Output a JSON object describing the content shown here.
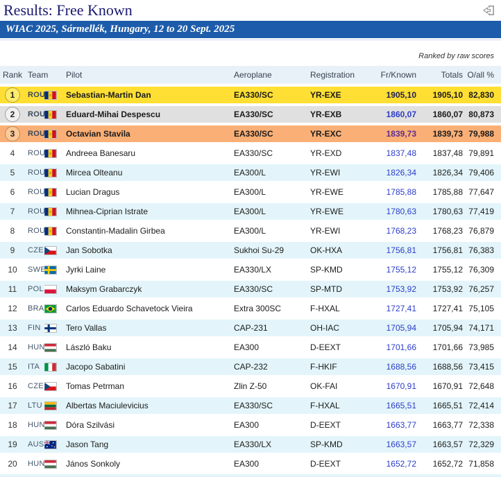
{
  "header": {
    "title": "Results: Free Known",
    "event": "WIAC 2025, Sármellék, Hungary, 12 to 20 Sept. 2025",
    "ranked_note": "Ranked by raw scores"
  },
  "colors": {
    "title_navy": "#191970",
    "event_bar_blue": "#1d5caa",
    "gold_row": "#ffdf33",
    "silver_row": "#e0e0e0",
    "bronze_row": "#faaf76",
    "alt_row_cyan": "#e3f5fa",
    "header_row_bg": "#e9f1f8",
    "link_blue": "#2b3cc8",
    "link_visited_purple": "#5e2d91",
    "link_dark_navy": "#20204e"
  },
  "icons": {
    "logout": "logout-icon"
  },
  "table": {
    "columns": [
      "Rank",
      "Team",
      "",
      "Pilot",
      "Aeroplane",
      "Registration",
      "Fr/Known",
      "Totals",
      "O/all %"
    ],
    "rows": [
      {
        "rank": 1,
        "team": "ROU",
        "flag": "rou",
        "pilot": "Sebastian-Martin Dan",
        "aeroplane": "EA330/SC",
        "registration": "YR-EXE",
        "fr_known": "1905,10",
        "totals": "1905,10",
        "overall": "82,830",
        "highlight": "gold",
        "link": "dark"
      },
      {
        "rank": 2,
        "team": "ROU",
        "flag": "rou",
        "pilot": "Eduard-Mihai Despescu",
        "aeroplane": "EA330/SC",
        "registration": "YR-EXB",
        "fr_known": "1860,07",
        "totals": "1860,07",
        "overall": "80,873",
        "highlight": "silver",
        "link": "blue"
      },
      {
        "rank": 3,
        "team": "ROU",
        "flag": "rou",
        "pilot": "Octavian Stavila",
        "aeroplane": "EA330/SC",
        "registration": "YR-EXC",
        "fr_known": "1839,73",
        "totals": "1839,73",
        "overall": "79,988",
        "highlight": "bronze",
        "link": "visited"
      },
      {
        "rank": 4,
        "team": "ROU",
        "flag": "rou",
        "pilot": "Andreea Banesaru",
        "aeroplane": "EA330/SC",
        "registration": "YR-EXD",
        "fr_known": "1837,48",
        "totals": "1837,48",
        "overall": "79,891",
        "highlight": "",
        "link": "blue"
      },
      {
        "rank": 5,
        "team": "ROU",
        "flag": "rou",
        "pilot": "Mircea Olteanu",
        "aeroplane": "EA300/L",
        "registration": "YR-EWI",
        "fr_known": "1826,34",
        "totals": "1826,34",
        "overall": "79,406",
        "highlight": "",
        "link": "blue"
      },
      {
        "rank": 6,
        "team": "ROU",
        "flag": "rou",
        "pilot": "Lucian Dragus",
        "aeroplane": "EA300/L",
        "registration": "YR-EWE",
        "fr_known": "1785,88",
        "totals": "1785,88",
        "overall": "77,647",
        "highlight": "",
        "link": "blue"
      },
      {
        "rank": 7,
        "team": "ROU",
        "flag": "rou",
        "pilot": "Mihnea-Ciprian Istrate",
        "aeroplane": "EA300/L",
        "registration": "YR-EWE",
        "fr_known": "1780,63",
        "totals": "1780,63",
        "overall": "77,419",
        "highlight": "",
        "link": "blue"
      },
      {
        "rank": 8,
        "team": "ROU",
        "flag": "rou",
        "pilot": "Constantin-Madalin Girbea",
        "aeroplane": "EA300/L",
        "registration": "YR-EWI",
        "fr_known": "1768,23",
        "totals": "1768,23",
        "overall": "76,879",
        "highlight": "",
        "link": "blue"
      },
      {
        "rank": 9,
        "team": "CZE",
        "flag": "cze",
        "pilot": "Jan Sobotka",
        "aeroplane": "Sukhoi Su-29",
        "registration": "OK-HXA",
        "fr_known": "1756,81",
        "totals": "1756,81",
        "overall": "76,383",
        "highlight": "",
        "link": "blue"
      },
      {
        "rank": 10,
        "team": "SWE",
        "flag": "swe",
        "pilot": "Jyrki Laine",
        "aeroplane": "EA330/LX",
        "registration": "SP-KMD",
        "fr_known": "1755,12",
        "totals": "1755,12",
        "overall": "76,309",
        "highlight": "",
        "link": "blue"
      },
      {
        "rank": 11,
        "team": "POL",
        "flag": "pol",
        "pilot": "Maksym Grabarczyk",
        "aeroplane": "EA330/SC",
        "registration": "SP-MTD",
        "fr_known": "1753,92",
        "totals": "1753,92",
        "overall": "76,257",
        "highlight": "",
        "link": "blue"
      },
      {
        "rank": 12,
        "team": "BRA",
        "flag": "bra",
        "pilot": "Carlos Eduardo Schavetock Vieira",
        "aeroplane": "Extra 300SC",
        "registration": "F-HXAL",
        "fr_known": "1727,41",
        "totals": "1727,41",
        "overall": "75,105",
        "highlight": "",
        "link": "blue"
      },
      {
        "rank": 13,
        "team": "FIN",
        "flag": "fin",
        "pilot": "Tero Vallas",
        "aeroplane": "CAP-231",
        "registration": "OH-IAC",
        "fr_known": "1705,94",
        "totals": "1705,94",
        "overall": "74,171",
        "highlight": "",
        "link": "blue"
      },
      {
        "rank": 14,
        "team": "HUN",
        "flag": "hun",
        "pilot": "László Baku",
        "aeroplane": "EA300",
        "registration": "D-EEXT",
        "fr_known": "1701,66",
        "totals": "1701,66",
        "overall": "73,985",
        "highlight": "",
        "link": "blue"
      },
      {
        "rank": 15,
        "team": "ITA",
        "flag": "ita",
        "pilot": "Jacopo Sabatini",
        "aeroplane": "CAP-232",
        "registration": "F-HKIF",
        "fr_known": "1688,56",
        "totals": "1688,56",
        "overall": "73,415",
        "highlight": "",
        "link": "blue"
      },
      {
        "rank": 16,
        "team": "CZE",
        "flag": "cze",
        "pilot": "Tomas Petrman",
        "aeroplane": "Zlin Z-50",
        "registration": "OK-FAI",
        "fr_known": "1670,91",
        "totals": "1670,91",
        "overall": "72,648",
        "highlight": "",
        "link": "blue"
      },
      {
        "rank": 17,
        "team": "LTU",
        "flag": "ltu",
        "pilot": "Albertas Maciulevicius",
        "aeroplane": "EA330/SC",
        "registration": "F-HXAL",
        "fr_known": "1665,51",
        "totals": "1665,51",
        "overall": "72,414",
        "highlight": "",
        "link": "blue"
      },
      {
        "rank": 18,
        "team": "HUN",
        "flag": "hun",
        "pilot": "Dóra Szilvási",
        "aeroplane": "EA300",
        "registration": "D-EEXT",
        "fr_known": "1663,77",
        "totals": "1663,77",
        "overall": "72,338",
        "highlight": "",
        "link": "blue"
      },
      {
        "rank": 19,
        "team": "AUS",
        "flag": "aus",
        "pilot": "Jason Tang",
        "aeroplane": "EA330/LX",
        "registration": "SP-KMD",
        "fr_known": "1663,57",
        "totals": "1663,57",
        "overall": "72,329",
        "highlight": "",
        "link": "blue"
      },
      {
        "rank": 20,
        "team": "HUN",
        "flag": "hun",
        "pilot": "János Sonkoly",
        "aeroplane": "EA300",
        "registration": "D-EEXT",
        "fr_known": "1652,72",
        "totals": "1652,72",
        "overall": "71,858",
        "highlight": "",
        "link": "blue"
      }
    ]
  }
}
